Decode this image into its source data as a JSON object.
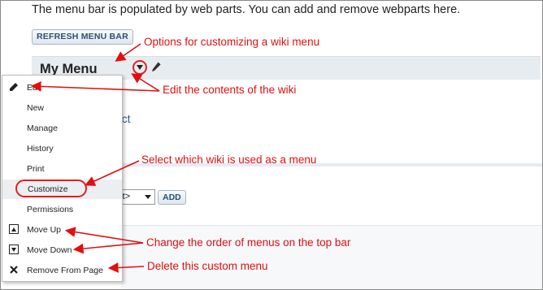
{
  "intro_text": "The menu bar is populated by web parts. You can add and remove webparts here.",
  "refresh_button": "REFRESH MENU BAR",
  "menu_header": {
    "title": "My Menu"
  },
  "content_link": "oject",
  "select": {
    "value": "rt>"
  },
  "add_button": "ADD",
  "dropdown": {
    "items": [
      {
        "label": "Edit",
        "icon": "pencil-icon"
      },
      {
        "label": "New",
        "icon": ""
      },
      {
        "label": "Manage",
        "icon": ""
      },
      {
        "label": "History",
        "icon": ""
      },
      {
        "label": "Print",
        "icon": ""
      },
      {
        "label": "Customize",
        "icon": "",
        "selected": true
      },
      {
        "label": "Permissions",
        "icon": ""
      },
      {
        "label": "Move Up",
        "icon": "move-up-icon"
      },
      {
        "label": "Move Down",
        "icon": "move-down-icon"
      },
      {
        "label": "Remove From Page",
        "icon": "close-icon"
      }
    ]
  },
  "annotations": {
    "options": "Options for customizing a wiki menu",
    "edit": "Edit the contents of the wiki",
    "select": "Select which wiki is used as a menu",
    "order": "Change the order of menus on the top bar",
    "delete": "Delete this custom menu"
  },
  "colors": {
    "annotation": "#e01010",
    "header_bg": "#e7ecf0",
    "button_text": "#2d4f76"
  }
}
